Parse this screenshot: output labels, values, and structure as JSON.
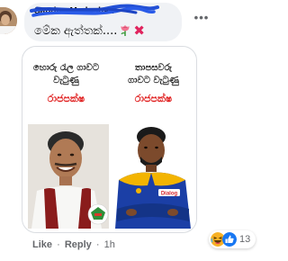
{
  "comment": {
    "author": "Sandun Madushan",
    "text": "මේක ඇත්තක්....",
    "emoji_icons": [
      "rose-icon",
      "cross-mark-icon"
    ]
  },
  "photo": {
    "left": {
      "headline": [
        "හොරු රැල ගාවට",
        "වැටුණු"
      ],
      "name": "රාජපක්ෂ"
    },
    "right": {
      "headline": [
        "තාපසවරු",
        "ගාවට වැටුණු"
      ],
      "name": "රාජපක්ෂ",
      "jersey_text": "Dialog"
    }
  },
  "actions": {
    "like": "Like",
    "separator": "·",
    "reply": "Reply",
    "time": "1h"
  },
  "reactions": {
    "icons": [
      "laughing-face-icon",
      "like-icon"
    ],
    "count": "13"
  },
  "colors": {
    "bubble": "#f0f2f5",
    "meme_name_red": "#e02020",
    "like_blue": "#1877f2",
    "haha_yellow": "#f7b125"
  }
}
